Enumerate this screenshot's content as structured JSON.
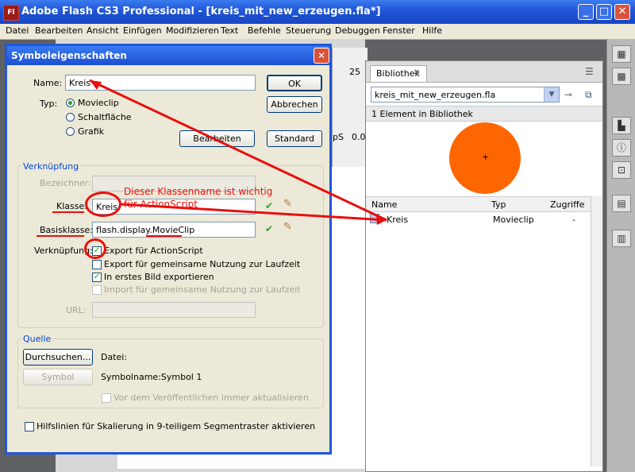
{
  "window": {
    "icon": "Fl",
    "title": "Adobe Flash CS3 Professional - [kreis_mit_new_erzeugen.fla*]",
    "minimize": "_",
    "maximize": "□",
    "close": "✕"
  },
  "menu": [
    "Datei",
    "Bearbeiten",
    "Ansicht",
    "Einfügen",
    "Modifizieren",
    "Text",
    "Befehle",
    "Steuerung",
    "Debuggen",
    "Fenster",
    "Hilfe"
  ],
  "background": {
    "frame_number": "25",
    "fps_fragment": "pS",
    "fps_value": "0.0"
  },
  "library": {
    "tab_label": "Bibliothek",
    "tab_close": "✕",
    "document": "kreis_mit_new_erzeugen.fla",
    "count": "1 Element in Bibliothek",
    "columns": [
      "Name",
      "Typ",
      "Zugriffe"
    ],
    "items": [
      {
        "name": "Kreis",
        "type": "Movieclip",
        "uses": "-"
      }
    ],
    "preview_color": "#ff6600"
  },
  "dialog": {
    "title": "Symboleigenschaften",
    "close": "✕",
    "name_label": "Name:",
    "name_value": "Kreis",
    "type_label": "Typ:",
    "type_options": [
      "Movieclip",
      "Schaltfläche",
      "Grafik"
    ],
    "type_selected": "Movieclip",
    "ok": "OK",
    "cancel": "Abbrechen",
    "edit": "Bearbeiten",
    "standard": "Standard",
    "linkage": {
      "title": "Verknüpfung",
      "identifier_label": "Bezeichner:",
      "class_label": "Klasse:",
      "class_value": "Kreis",
      "base_class_label": "Basisklasse:",
      "base_class_value_prefix": "flash.display.",
      "base_class_value_suffix": "MovieClip",
      "linkage_label": "Verknüpfung:",
      "options": [
        {
          "label": "Export für ActionScript",
          "checked": true,
          "enabled": true
        },
        {
          "label": "Export für gemeinsame Nutzung zur Laufzeit",
          "checked": false,
          "enabled": true
        },
        {
          "label": "In erstes Bild exportieren",
          "checked": true,
          "enabled": true
        },
        {
          "label": "Import für gemeinsame Nutzung zur Laufzeit",
          "checked": false,
          "enabled": false
        }
      ],
      "url_label": "URL:"
    },
    "source": {
      "title": "Quelle",
      "browse": "Durchsuchen...",
      "file_label": "Datei:",
      "symbol_button": "Symbol",
      "symbol_name": "Symbolname:Symbol 1",
      "always_update": "Vor dem Veröffentlichen immer aktualisieren"
    },
    "guides": "Hilfslinien für Skalierung in 9-teiligem Segmentraster aktivieren"
  },
  "annotation": {
    "line1": "Dieser Klassenname ist wichtig",
    "line2": "für ActionScript",
    "color": "#e8100e"
  }
}
